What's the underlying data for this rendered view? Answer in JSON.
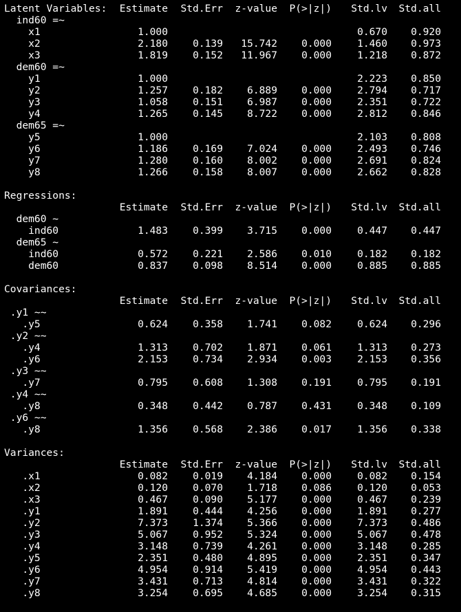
{
  "columns": [
    "Estimate",
    "Std.Err",
    "z-value",
    "P(>|z|)",
    "Std.lv",
    "Std.all"
  ],
  "lines": [
    {
      "label": "Latent Variables:",
      "header": true
    },
    {
      "label": "  ind60 =~"
    },
    {
      "label": "    x1",
      "values": [
        "1.000",
        "",
        "",
        "",
        "0.670",
        "0.920"
      ]
    },
    {
      "label": "    x2",
      "values": [
        "2.180",
        "0.139",
        "15.742",
        "0.000",
        "1.460",
        "0.973"
      ]
    },
    {
      "label": "    x3",
      "values": [
        "1.819",
        "0.152",
        "11.967",
        "0.000",
        "1.218",
        "0.872"
      ]
    },
    {
      "label": "  dem60 =~"
    },
    {
      "label": "    y1",
      "values": [
        "1.000",
        "",
        "",
        "",
        "2.223",
        "0.850"
      ]
    },
    {
      "label": "    y2",
      "values": [
        "1.257",
        "0.182",
        "6.889",
        "0.000",
        "2.794",
        "0.717"
      ]
    },
    {
      "label": "    y3",
      "values": [
        "1.058",
        "0.151",
        "6.987",
        "0.000",
        "2.351",
        "0.722"
      ]
    },
    {
      "label": "    y4",
      "values": [
        "1.265",
        "0.145",
        "8.722",
        "0.000",
        "2.812",
        "0.846"
      ]
    },
    {
      "label": "  dem65 =~"
    },
    {
      "label": "    y5",
      "values": [
        "1.000",
        "",
        "",
        "",
        "2.103",
        "0.808"
      ]
    },
    {
      "label": "    y6",
      "values": [
        "1.186",
        "0.169",
        "7.024",
        "0.000",
        "2.493",
        "0.746"
      ]
    },
    {
      "label": "    y7",
      "values": [
        "1.280",
        "0.160",
        "8.002",
        "0.000",
        "2.691",
        "0.824"
      ]
    },
    {
      "label": "    y8",
      "values": [
        "1.266",
        "0.158",
        "8.007",
        "0.000",
        "2.662",
        "0.828"
      ]
    },
    {
      "label": ""
    },
    {
      "label": "Regressions:"
    },
    {
      "label": "",
      "header": true
    },
    {
      "label": "  dem60 ~"
    },
    {
      "label": "    ind60",
      "values": [
        "1.483",
        "0.399",
        "3.715",
        "0.000",
        "0.447",
        "0.447"
      ]
    },
    {
      "label": "  dem65 ~"
    },
    {
      "label": "    ind60",
      "values": [
        "0.572",
        "0.221",
        "2.586",
        "0.010",
        "0.182",
        "0.182"
      ]
    },
    {
      "label": "    dem60",
      "values": [
        "0.837",
        "0.098",
        "8.514",
        "0.000",
        "0.885",
        "0.885"
      ]
    },
    {
      "label": ""
    },
    {
      "label": "Covariances:"
    },
    {
      "label": "",
      "header": true
    },
    {
      "label": " .y1 ~~"
    },
    {
      "label": "   .y5",
      "values": [
        "0.624",
        "0.358",
        "1.741",
        "0.082",
        "0.624",
        "0.296"
      ]
    },
    {
      "label": " .y2 ~~"
    },
    {
      "label": "   .y4",
      "values": [
        "1.313",
        "0.702",
        "1.871",
        "0.061",
        "1.313",
        "0.273"
      ]
    },
    {
      "label": "   .y6",
      "values": [
        "2.153",
        "0.734",
        "2.934",
        "0.003",
        "2.153",
        "0.356"
      ]
    },
    {
      "label": " .y3 ~~"
    },
    {
      "label": "   .y7",
      "values": [
        "0.795",
        "0.608",
        "1.308",
        "0.191",
        "0.795",
        "0.191"
      ]
    },
    {
      "label": " .y4 ~~"
    },
    {
      "label": "   .y8",
      "values": [
        "0.348",
        "0.442",
        "0.787",
        "0.431",
        "0.348",
        "0.109"
      ]
    },
    {
      "label": " .y6 ~~"
    },
    {
      "label": "   .y8",
      "values": [
        "1.356",
        "0.568",
        "2.386",
        "0.017",
        "1.356",
        "0.338"
      ]
    },
    {
      "label": ""
    },
    {
      "label": "Variances:"
    },
    {
      "label": "",
      "header": true
    },
    {
      "label": "   .x1",
      "values": [
        "0.082",
        "0.019",
        "4.184",
        "0.000",
        "0.082",
        "0.154"
      ]
    },
    {
      "label": "   .x2",
      "values": [
        "0.120",
        "0.070",
        "1.718",
        "0.086",
        "0.120",
        "0.053"
      ]
    },
    {
      "label": "   .x3",
      "values": [
        "0.467",
        "0.090",
        "5.177",
        "0.000",
        "0.467",
        "0.239"
      ]
    },
    {
      "label": "   .y1",
      "values": [
        "1.891",
        "0.444",
        "4.256",
        "0.000",
        "1.891",
        "0.277"
      ]
    },
    {
      "label": "   .y2",
      "values": [
        "7.373",
        "1.374",
        "5.366",
        "0.000",
        "7.373",
        "0.486"
      ]
    },
    {
      "label": "   .y3",
      "values": [
        "5.067",
        "0.952",
        "5.324",
        "0.000",
        "5.067",
        "0.478"
      ]
    },
    {
      "label": "   .y4",
      "values": [
        "3.148",
        "0.739",
        "4.261",
        "0.000",
        "3.148",
        "0.285"
      ]
    },
    {
      "label": "   .y5",
      "values": [
        "2.351",
        "0.480",
        "4.895",
        "0.000",
        "2.351",
        "0.347"
      ]
    },
    {
      "label": "   .y6",
      "values": [
        "4.954",
        "0.914",
        "5.419",
        "0.000",
        "4.954",
        "0.443"
      ]
    },
    {
      "label": "   .y7",
      "values": [
        "3.431",
        "0.713",
        "4.814",
        "0.000",
        "3.431",
        "0.322"
      ]
    },
    {
      "label": "   .y8",
      "values": [
        "3.254",
        "0.695",
        "4.685",
        "0.000",
        "3.254",
        "0.315"
      ]
    }
  ]
}
